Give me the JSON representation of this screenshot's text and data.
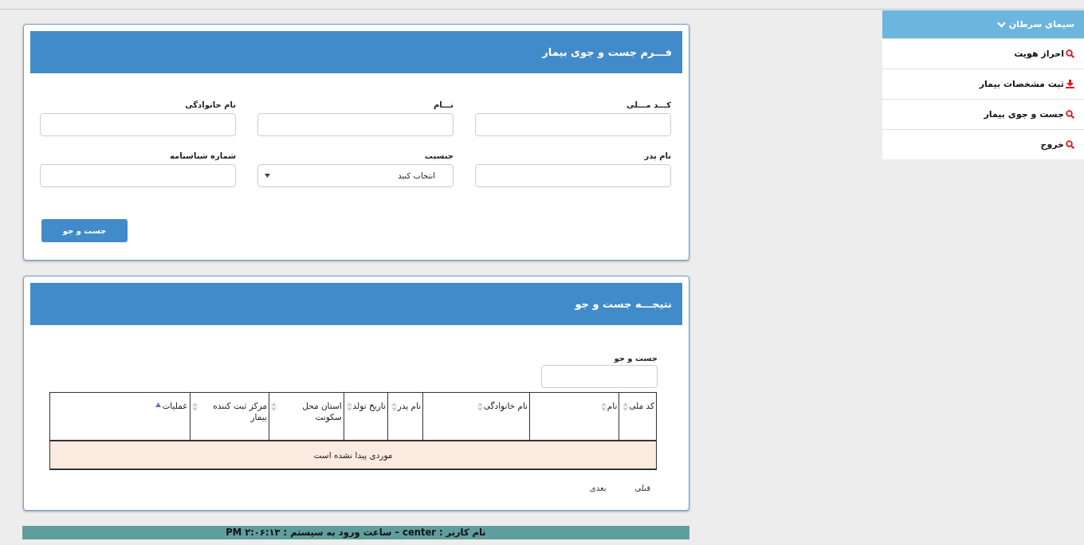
{
  "sidebar": {
    "title": "سیمای سرطان",
    "expanded": true,
    "items": [
      {
        "label": "احراز هویت",
        "kind": "search"
      },
      {
        "label": "ثبت مشخصات بیمار",
        "kind": "download"
      },
      {
        "label": "جست و جوی بیمار",
        "kind": "search"
      },
      {
        "label": "خروج",
        "kind": "search"
      }
    ]
  },
  "search_form": {
    "title": "فـــرم جست و جوی بیمار",
    "fields": [
      {
        "label": "کـــد مـــلی",
        "kind": "text"
      },
      {
        "label": "نـــام",
        "kind": "text"
      },
      {
        "label": "نام خانوادگی",
        "kind": "text"
      },
      {
        "label": "نام پدر",
        "kind": "text"
      },
      {
        "label": "جنسیت",
        "kind": "select",
        "value": "انتخاب کنید"
      },
      {
        "label": "شماره شناسنامه",
        "kind": "text"
      }
    ],
    "button": "جست و جو"
  },
  "results": {
    "title": "نتیجـــه جست و جو",
    "filter_label": "جست و جو",
    "table": {
      "columns": [
        {
          "label": "کد ملی",
          "sorted": false
        },
        {
          "label": "نام",
          "sorted": false
        },
        {
          "label": "نام خانوادگی",
          "sorted": false
        },
        {
          "label": "نام پدر",
          "sorted": false
        },
        {
          "label": "تاریخ تولد",
          "sorted": false
        },
        {
          "label": "استان محل سکونت",
          "sorted": false
        },
        {
          "label": "مرکز ثبت کننده بیمار",
          "sorted": false
        },
        {
          "label": "عملیات",
          "sorted": true
        }
      ],
      "empty_message": "موردی پیدا نشده است"
    },
    "pagination": {
      "previous": "قبلی",
      "next": "بعدی"
    }
  },
  "status_bar": "نام کاربر : center – ساعت ورود به سیستم : ۲:۰۶:۱۳ PM"
}
